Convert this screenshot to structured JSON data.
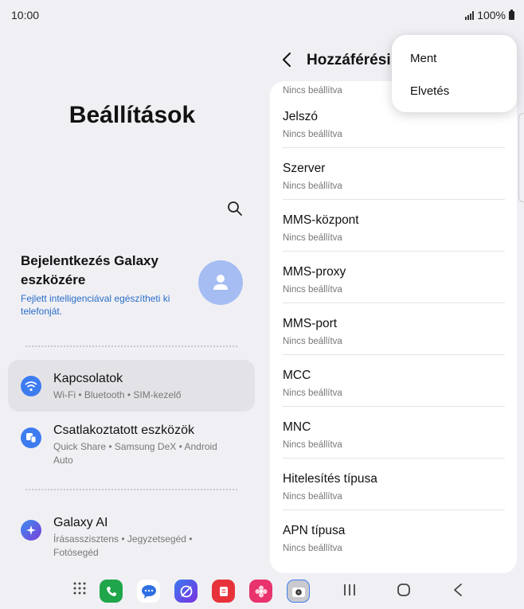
{
  "status_bar": {
    "time": "10:00",
    "battery": "100%"
  },
  "left_pane": {
    "title": "Beállítások",
    "account": {
      "title": "Bejelentkezés Galaxy eszközére",
      "subtitle": "Fejlett intelligenciával egészítheti ki telefonját."
    },
    "menu": [
      {
        "title": "Kapcsolatok",
        "subtitle": "Wi-Fi • Bluetooth • SIM-kezelő",
        "icon": "wifi-icon",
        "color": "#3d7cf0"
      },
      {
        "title": "Csatlakoztatott eszközök",
        "subtitle": "Quick Share • Samsung DeX • Android Auto",
        "icon": "connected-devices-icon",
        "color": "#3d7cf0"
      },
      {
        "title": "Galaxy AI",
        "subtitle": "Írásasszisztens • Jegyzetsegéd • Fotósegéd",
        "icon": "galaxy-ai-icon",
        "color": "#5a4fd8"
      }
    ]
  },
  "right_pane": {
    "title": "Hozzáférési",
    "partial_value": "Nincs beállítva",
    "fields": [
      {
        "label": "Jelszó",
        "value": "Nincs beállítva"
      },
      {
        "label": "Szerver",
        "value": "Nincs beállítva"
      },
      {
        "label": "MMS-központ",
        "value": "Nincs beállítva"
      },
      {
        "label": "MMS-proxy",
        "value": "Nincs beállítva"
      },
      {
        "label": "MMS-port",
        "value": "Nincs beállítva"
      },
      {
        "label": "MCC",
        "value": "Nincs beállítva"
      },
      {
        "label": "MNC",
        "value": "Nincs beállítva"
      },
      {
        "label": "Hitelesítés típusa",
        "value": "Nincs beállítva"
      },
      {
        "label": "APN típusa",
        "value": "Nincs beállítva"
      }
    ]
  },
  "popup_menu": {
    "items": [
      "Ment",
      "Elvetés"
    ]
  },
  "taskbar": {
    "apps": [
      {
        "name": "phone-app-icon",
        "color": "#1fa64a"
      },
      {
        "name": "messages-app-icon",
        "color": "#ffffff"
      },
      {
        "name": "internet-app-icon",
        "color": "#6a3fe0"
      },
      {
        "name": "notes-app-icon",
        "color": "#e8323a"
      },
      {
        "name": "gallery-app-icon",
        "color": "#e8336d"
      },
      {
        "name": "camera-app-icon",
        "color": "#c9c9ce"
      }
    ]
  }
}
